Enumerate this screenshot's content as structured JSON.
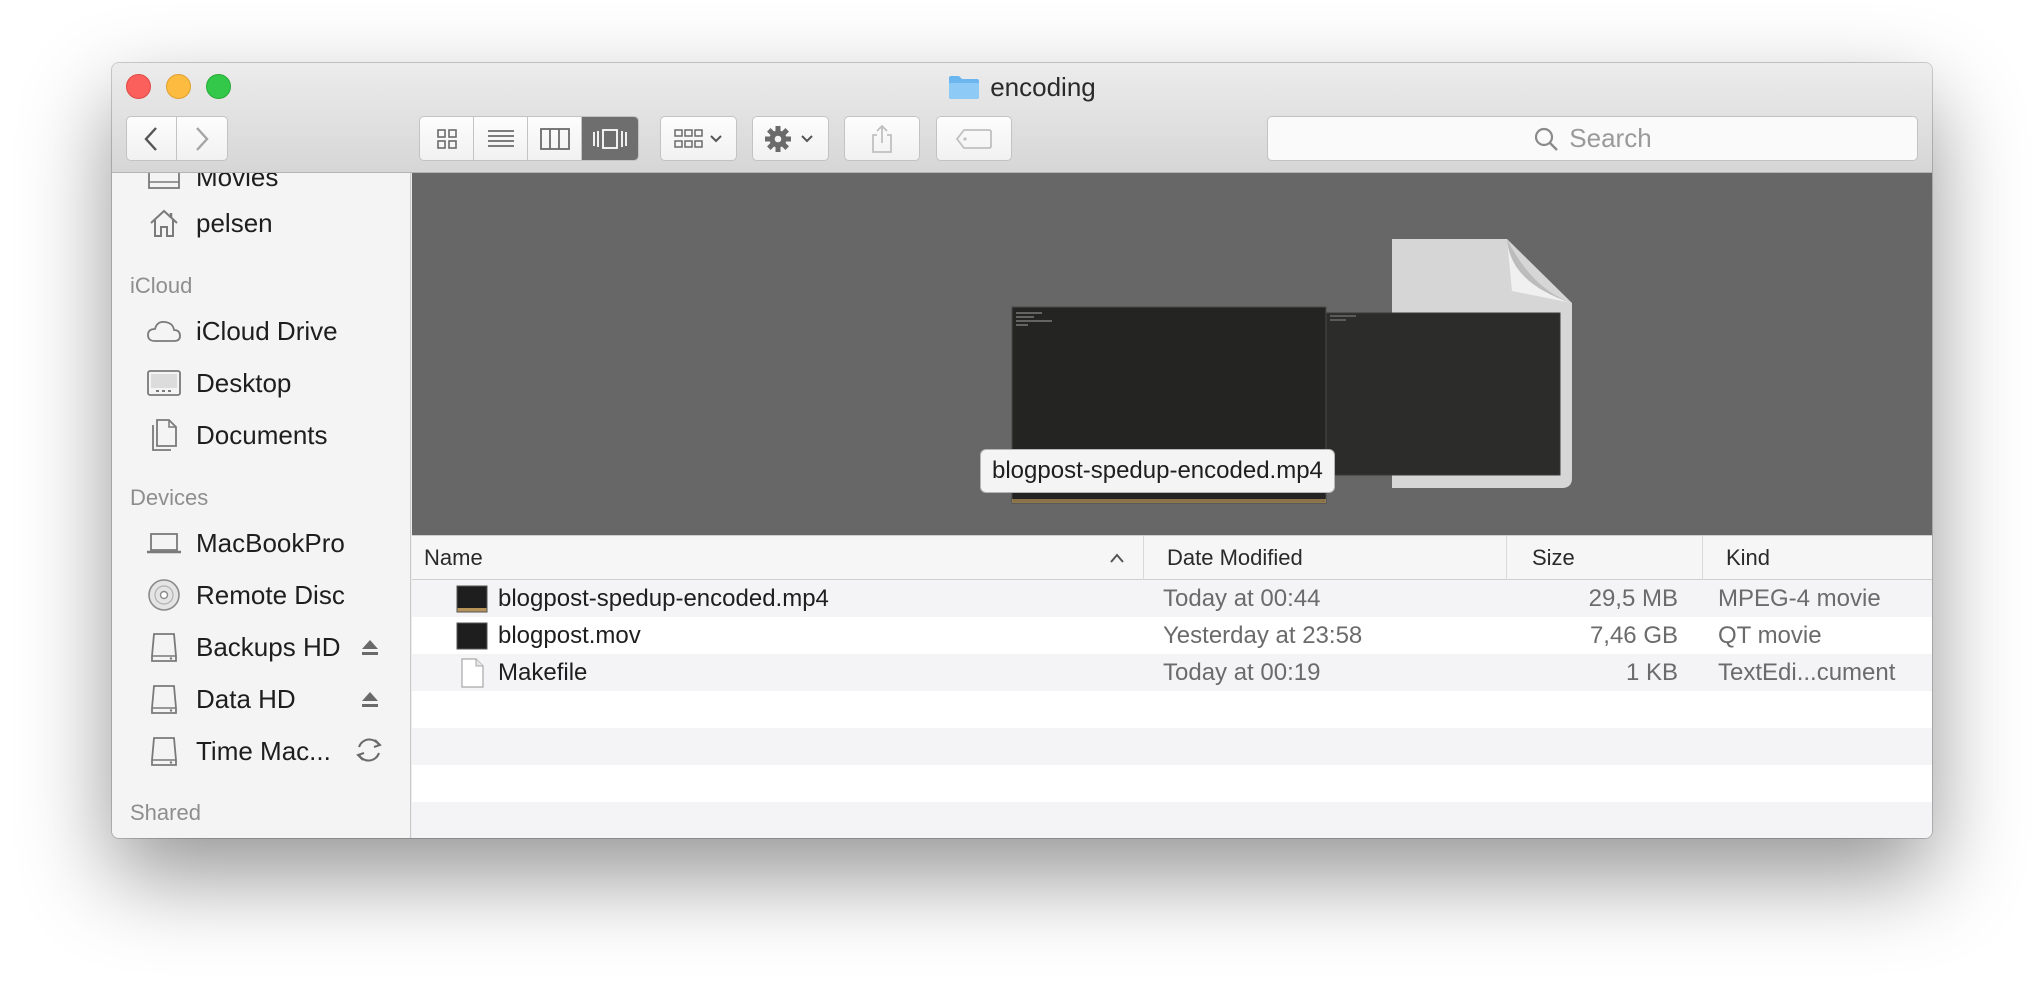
{
  "window": {
    "title": "encoding"
  },
  "toolbar": {
    "search_placeholder": "Search"
  },
  "sidebar": {
    "partial_item": "Movies",
    "home_item": "pelsen",
    "icloud_header": "iCloud",
    "icloud_items": [
      "iCloud Drive",
      "Desktop",
      "Documents"
    ],
    "devices_header": "Devices",
    "devices": [
      "MacBookPro",
      "Remote Disc",
      "Backups HD",
      "Data HD",
      "Time Mac..."
    ],
    "shared_header": "Shared"
  },
  "coverflow": {
    "selected_label": "blogpost-spedup-encoded.mp4"
  },
  "list": {
    "columns": {
      "name": "Name",
      "date": "Date Modified",
      "size": "Size",
      "kind": "Kind"
    },
    "rows": [
      {
        "name": "blogpost-spedup-encoded.mp4",
        "date": "Today at 00:44",
        "size": "29,5 MB",
        "kind": "MPEG-4 movie"
      },
      {
        "name": "blogpost.mov",
        "date": "Yesterday at 23:58",
        "size": "7,46 GB",
        "kind": "QT movie"
      },
      {
        "name": "Makefile",
        "date": "Today at 00:19",
        "size": "1 KB",
        "kind": "TextEdi...cument"
      }
    ]
  },
  "colors": {
    "close": "#fc605c",
    "minimize": "#fdbc40",
    "maximize": "#34c84a",
    "coverflow_bg": "#676767",
    "folder_blue": "#6cb6f0"
  },
  "icons": [
    "back-chevron",
    "forward-chevron",
    "icon-view",
    "list-view",
    "column-view",
    "coverflow-view",
    "group-arrange",
    "gear-action",
    "share",
    "tag",
    "search",
    "movies",
    "home",
    "cloud",
    "desktop",
    "documents",
    "laptop",
    "disc",
    "drive",
    "eject",
    "sync"
  ]
}
